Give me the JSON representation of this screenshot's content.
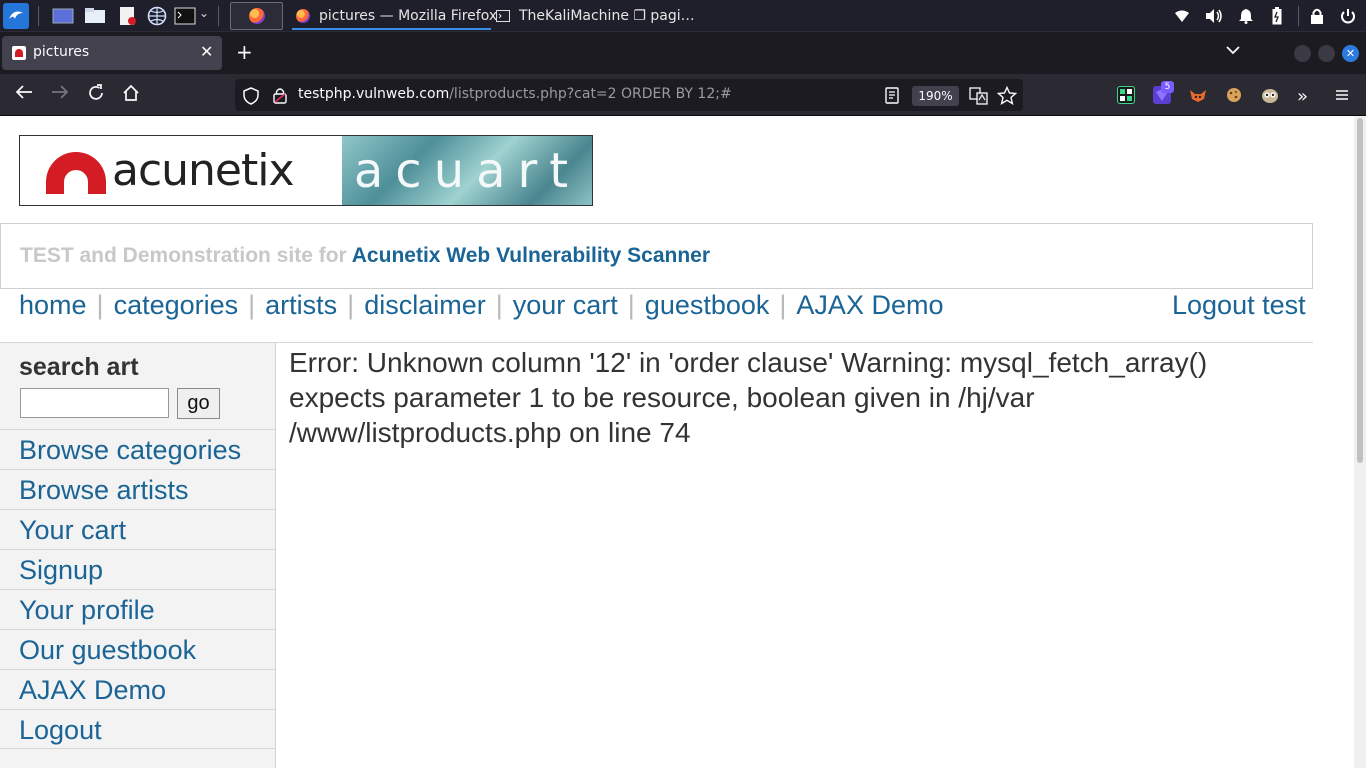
{
  "taskbar": {
    "active_task_title": "pictures — Mozilla Firefox",
    "other_task_title": "TheKaliMachine ❐ pagi…"
  },
  "browser": {
    "tab_title": "pictures",
    "url_host": "testphp.vulnweb.com",
    "url_path": "/listproducts.php?cat=2 ORDER BY 12;#",
    "url_prefix": "",
    "zoom": "190%",
    "extension_badge": "5"
  },
  "site": {
    "logo_left": "acunetix",
    "logo_right": "acuart",
    "banner_prefix": "TEST and Demonstration site for ",
    "banner_link": "Acunetix Web Vulnerability Scanner",
    "nav": [
      "home",
      "categories",
      "artists",
      "disclaimer",
      "your cart",
      "guestbook",
      "AJAX Demo"
    ],
    "nav_separator": "|",
    "logout_label": "Logout test",
    "search_title": "search art",
    "search_value": "",
    "go_label": "go",
    "sidebar": [
      "Browse categories",
      "Browse artists",
      "Your cart",
      "Signup",
      "Your profile",
      "Our guestbook",
      "AJAX Demo",
      "Logout"
    ],
    "error_message": "Error: Unknown column '12' in 'order clause' Warning: mysql_fetch_array() expects parameter 1 to be resource, boolean given in /hj/var /www/listproducts.php on line 74"
  },
  "colors": {
    "link": "#1a6496",
    "accent_underline": "#3b8ce8",
    "brand_red": "#d41c24"
  },
  "icons": {
    "kali": "kali-dragon-icon",
    "firefox": "firefox-icon",
    "shield": "shield-icon",
    "lock": "lock-icon",
    "reader": "reader-view-icon",
    "translate": "translate-icon",
    "star": "star-icon"
  }
}
